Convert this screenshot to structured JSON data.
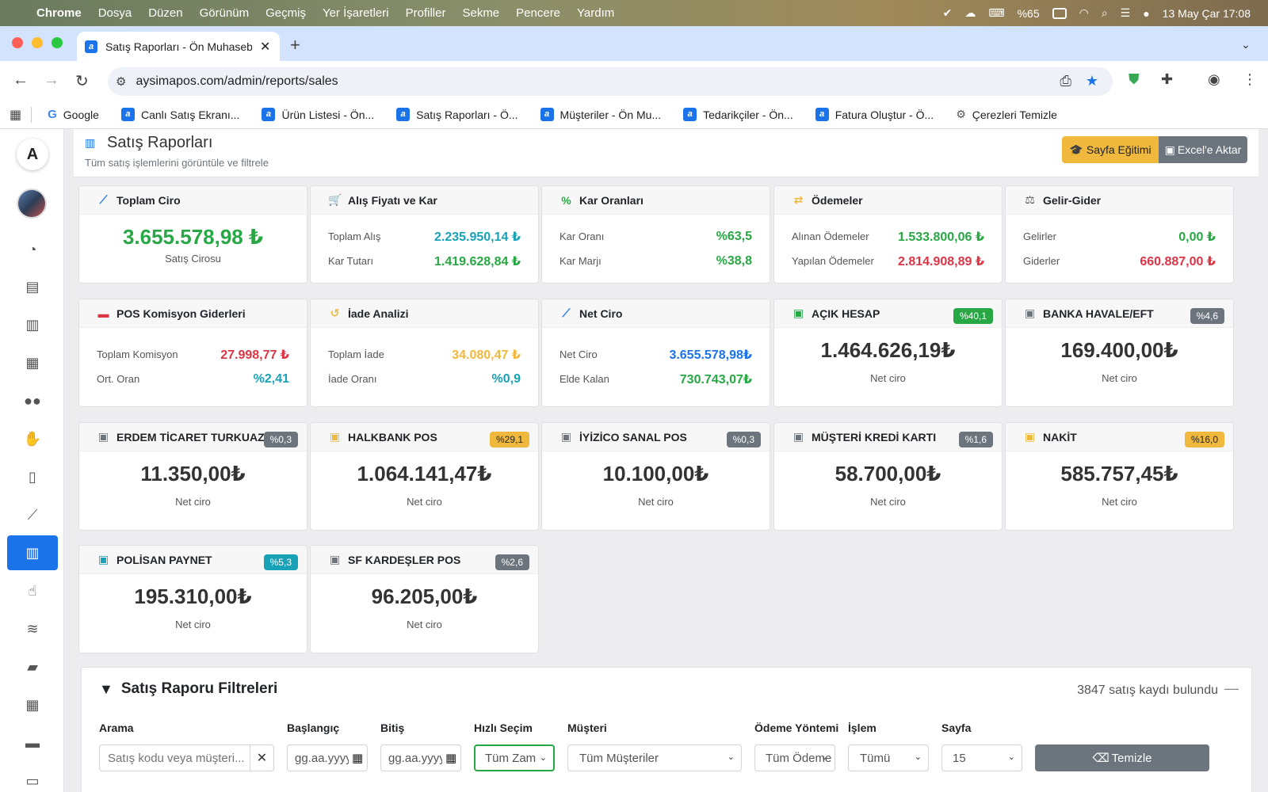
{
  "menubar": {
    "app": "Chrome",
    "items": [
      "Dosya",
      "Düzen",
      "Görünüm",
      "Geçmiş",
      "Yer İşaretleri",
      "Profiller",
      "Sekme",
      "Pencere",
      "Yardım"
    ],
    "battery": "%65",
    "datetime": "13 May Çar  17:08"
  },
  "browser": {
    "tab_title": "Satış Raporları - Ön Muhaseb",
    "url": "aysimapos.com/admin/reports/sales",
    "bookmarks": [
      {
        "label": "Google"
      },
      {
        "label": "Canlı Satış Ekranı..."
      },
      {
        "label": "Ürün Listesi - Ön..."
      },
      {
        "label": "Satış Raporları - Ö..."
      },
      {
        "label": "Müşteriler - Ön Mu..."
      },
      {
        "label": "Tedarikçiler - Ön..."
      },
      {
        "label": "Fatura Oluştur - Ö..."
      },
      {
        "label": "Çerezleri Temizle"
      }
    ]
  },
  "page": {
    "title": "Satış Raporları",
    "subtitle": "Tüm satış işlemlerini görüntüle ve filtrele",
    "btn_training": "Sayfa Eğitimi",
    "btn_excel": "Excel'e Aktar"
  },
  "cards": {
    "ciro": {
      "title": "Toplam Ciro",
      "value": "3.655.578,98 ₺",
      "label": "Satış Cirosu"
    },
    "alis": {
      "title": "Alış Fiyatı ve Kar",
      "r1k": "Toplam Alış",
      "r1v": "2.235.950,14 ₺",
      "r2k": "Kar Tutarı",
      "r2v": "1.419.628,84 ₺"
    },
    "oran": {
      "title": "Kar Oranları",
      "r1k": "Kar Oranı",
      "r1v": "%63,5",
      "r2k": "Kar Marjı",
      "r2v": "%38,8"
    },
    "odeme": {
      "title": "Ödemeler",
      "r1k": "Alınan Ödemeler",
      "r1v": "1.533.800,06 ₺",
      "r2k": "Yapılan Ödemeler",
      "r2v": "2.814.908,89 ₺"
    },
    "gelir": {
      "title": "Gelir-Gider",
      "r1k": "Gelirler",
      "r1v": "0,00 ₺",
      "r2k": "Giderler",
      "r2v": "660.887,00 ₺"
    },
    "pos": {
      "title": "POS Komisyon Giderleri",
      "r1k": "Toplam Komisyon",
      "r1v": "27.998,77 ₺",
      "r2k": "Ort. Oran",
      "r2v": "%2,41"
    },
    "iade": {
      "title": "İade Analizi",
      "r1k": "Toplam İade",
      "r1v": "34.080,47 ₺",
      "r2k": "İade Oranı",
      "r2v": "%0,9"
    },
    "net": {
      "title": "Net Ciro",
      "r1k": "Net Ciro",
      "r1v": "3.655.578,98₺",
      "r2k": "Elde Kalan",
      "r2v": "730.743,07₺"
    }
  },
  "payment_methods": [
    {
      "name": "AÇIK HESAP",
      "badge": "%40,1",
      "amount": "1.464.626,19₺",
      "label": "Net ciro",
      "badge_color": "#28a745"
    },
    {
      "name": "BANKA HAVALE/EFT",
      "badge": "%4,6",
      "amount": "169.400,00₺",
      "label": "Net ciro",
      "badge_color": "#6c757d"
    },
    {
      "name": "ERDEM TİCARET TURKUAZ",
      "badge": "%0,3",
      "amount": "11.350,00₺",
      "label": "Net ciro",
      "badge_color": "#6c757d"
    },
    {
      "name": "HALKBANK POS",
      "badge": "%29,1",
      "amount": "1.064.141,47₺",
      "label": "Net ciro",
      "badge_color": "#f0b83c"
    },
    {
      "name": "İYİZİCO SANAL POS",
      "badge": "%0,3",
      "amount": "10.100,00₺",
      "label": "Net ciro",
      "badge_color": "#6c757d"
    },
    {
      "name": "MÜŞTERİ KREDİ KARTI",
      "badge": "%1,6",
      "amount": "58.700,00₺",
      "label": "Net ciro",
      "badge_color": "#6c757d"
    },
    {
      "name": "NAKİT",
      "badge": "%16,0",
      "amount": "585.757,45₺",
      "label": "Net ciro",
      "badge_color": "#f0b83c"
    },
    {
      "name": "POLİSAN PAYNET",
      "badge": "%5,3",
      "amount": "195.310,00₺",
      "label": "Net ciro",
      "badge_color": "#17a2b8"
    },
    {
      "name": "SF KARDEŞLER POS",
      "badge": "%2,6",
      "amount": "96.205,00₺",
      "label": "Net ciro",
      "badge_color": "#6c757d"
    }
  ],
  "filters": {
    "title": "Satış Raporu Filtreleri",
    "count": "3847 satış kaydı bulundu",
    "arama_label": "Arama",
    "arama_placeholder": "Satış kodu veya müşteri...",
    "bas_label": "Başlangıç",
    "bas_value": "gg.aa.yyyy",
    "bit_label": "Bitiş",
    "bit_value": "gg.aa.yyyy",
    "hizli_label": "Hızlı Seçim",
    "hizli_value": "Tüm Zam",
    "musteri_label": "Müşteri",
    "musteri_value": "Tüm Müşteriler",
    "odeme_label": "Ödeme Yöntemi",
    "odeme_value": "Tüm Ödeme",
    "islem_label": "İşlem",
    "islem_value": "Tümü",
    "sayfa_label": "Sayfa",
    "sayfa_value": "15",
    "clear_label": "Temizle"
  }
}
